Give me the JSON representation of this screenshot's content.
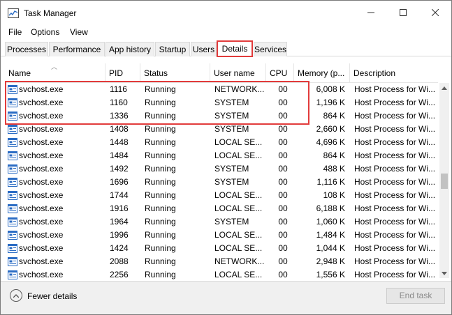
{
  "window": {
    "title": "Task Manager"
  },
  "menu": [
    "File",
    "Options",
    "View"
  ],
  "tabs": [
    "Processes",
    "Performance",
    "App history",
    "Startup",
    "Users",
    "Details",
    "Services"
  ],
  "active_tab": "Details",
  "columns": {
    "name": "Name",
    "pid": "PID",
    "status": "Status",
    "user": "User name",
    "cpu": "CPU",
    "memory": "Memory (p...",
    "description": "Description"
  },
  "rows": [
    {
      "name": "svchost.exe",
      "pid": "1116",
      "status": "Running",
      "user": "NETWORK...",
      "cpu": "00",
      "memory": "6,008 K",
      "description": "Host Process for Wi..."
    },
    {
      "name": "svchost.exe",
      "pid": "1160",
      "status": "Running",
      "user": "SYSTEM",
      "cpu": "00",
      "memory": "1,196 K",
      "description": "Host Process for Wi..."
    },
    {
      "name": "svchost.exe",
      "pid": "1336",
      "status": "Running",
      "user": "SYSTEM",
      "cpu": "00",
      "memory": "864 K",
      "description": "Host Process for Wi..."
    },
    {
      "name": "svchost.exe",
      "pid": "1408",
      "status": "Running",
      "user": "SYSTEM",
      "cpu": "00",
      "memory": "2,660 K",
      "description": "Host Process for Wi..."
    },
    {
      "name": "svchost.exe",
      "pid": "1448",
      "status": "Running",
      "user": "LOCAL SE...",
      "cpu": "00",
      "memory": "4,696 K",
      "description": "Host Process for Wi..."
    },
    {
      "name": "svchost.exe",
      "pid": "1484",
      "status": "Running",
      "user": "LOCAL SE...",
      "cpu": "00",
      "memory": "864 K",
      "description": "Host Process for Wi..."
    },
    {
      "name": "svchost.exe",
      "pid": "1492",
      "status": "Running",
      "user": "SYSTEM",
      "cpu": "00",
      "memory": "488 K",
      "description": "Host Process for Wi..."
    },
    {
      "name": "svchost.exe",
      "pid": "1696",
      "status": "Running",
      "user": "SYSTEM",
      "cpu": "00",
      "memory": "1,116 K",
      "description": "Host Process for Wi..."
    },
    {
      "name": "svchost.exe",
      "pid": "1744",
      "status": "Running",
      "user": "LOCAL SE...",
      "cpu": "00",
      "memory": "108 K",
      "description": "Host Process for Wi..."
    },
    {
      "name": "svchost.exe",
      "pid": "1916",
      "status": "Running",
      "user": "LOCAL SE...",
      "cpu": "00",
      "memory": "6,188 K",
      "description": "Host Process for Wi..."
    },
    {
      "name": "svchost.exe",
      "pid": "1964",
      "status": "Running",
      "user": "SYSTEM",
      "cpu": "00",
      "memory": "1,060 K",
      "description": "Host Process for Wi..."
    },
    {
      "name": "svchost.exe",
      "pid": "1996",
      "status": "Running",
      "user": "LOCAL SE...",
      "cpu": "00",
      "memory": "1,484 K",
      "description": "Host Process for Wi..."
    },
    {
      "name": "svchost.exe",
      "pid": "1424",
      "status": "Running",
      "user": "LOCAL SE...",
      "cpu": "00",
      "memory": "1,044 K",
      "description": "Host Process for Wi..."
    },
    {
      "name": "svchost.exe",
      "pid": "2088",
      "status": "Running",
      "user": "NETWORK...",
      "cpu": "00",
      "memory": "2,948 K",
      "description": "Host Process for Wi..."
    },
    {
      "name": "svchost.exe",
      "pid": "2256",
      "status": "Running",
      "user": "LOCAL SE...",
      "cpu": "00",
      "memory": "1,556 K",
      "description": "Host Process for Wi..."
    }
  ],
  "footer": {
    "fewer_details": "Fewer details",
    "end_task": "End task"
  },
  "colors": {
    "highlight": "#e23b3b",
    "icon_blue": "#2b6cc4"
  }
}
